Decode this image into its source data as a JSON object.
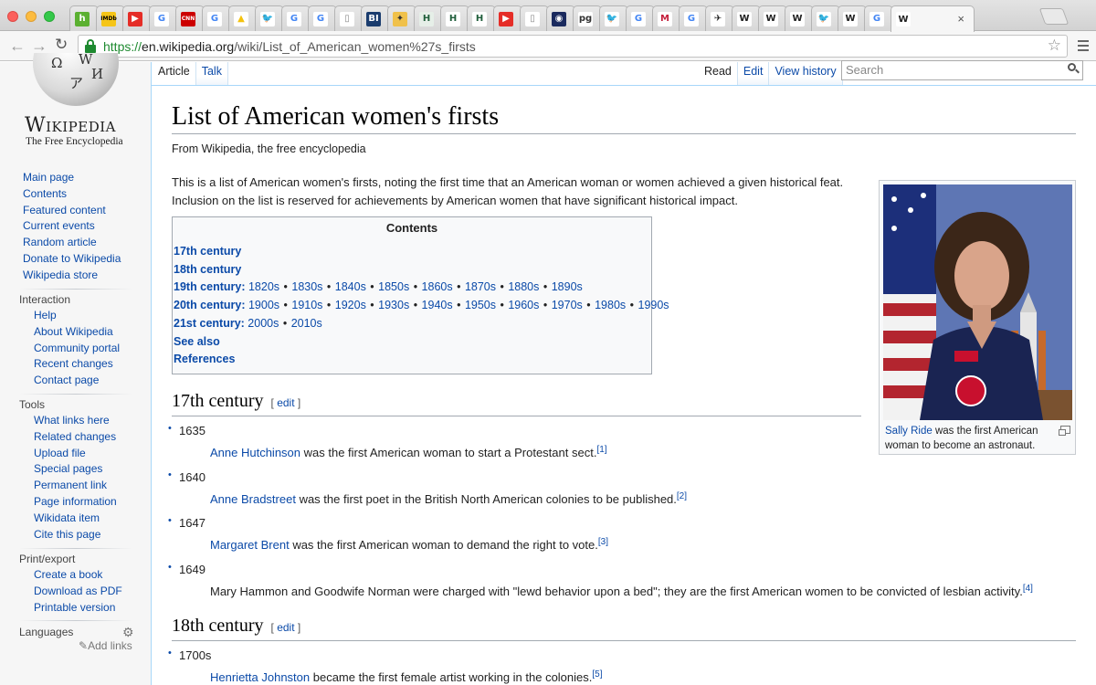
{
  "browser": {
    "url_scheme": "https://",
    "url_host": "en.wikipedia.org",
    "url_path": "/wiki/List_of_American_women%27s_firsts",
    "tabs": [
      {
        "icon": "h",
        "title": "",
        "color": "#5bb031",
        "fg": "#fff"
      },
      {
        "icon": "IMDb",
        "title": "",
        "color": "#f5c518",
        "fg": "#000"
      },
      {
        "icon": "▶",
        "title": "",
        "color": "#e52d27",
        "fg": "#fff"
      },
      {
        "icon": "G",
        "title": "",
        "color": "#fff",
        "fg": "#4285f4"
      },
      {
        "icon": "CNN",
        "title": "",
        "color": "#cc0000",
        "fg": "#fff"
      },
      {
        "icon": "G",
        "title": "",
        "color": "#fff",
        "fg": "#4285f4"
      },
      {
        "icon": "▲",
        "title": "",
        "color": "#fff",
        "fg": "#f4c20d"
      },
      {
        "icon": "🐦",
        "title": "",
        "color": "#fff",
        "fg": "#1da1f2"
      },
      {
        "icon": "G",
        "title": "",
        "color": "#fff",
        "fg": "#4285f4"
      },
      {
        "icon": "G",
        "title": "",
        "color": "#fff",
        "fg": "#4285f4"
      },
      {
        "icon": "▯",
        "title": "",
        "color": "#fff",
        "fg": "#888"
      },
      {
        "icon": "BI",
        "title": "",
        "color": "#1a3c6e",
        "fg": "#fff"
      },
      {
        "icon": "✦",
        "title": "",
        "color": "#f0c14b",
        "fg": "#333"
      },
      {
        "icon": "H",
        "title": "",
        "color": "#e6efe8",
        "fg": "#205e3b"
      },
      {
        "icon": "H",
        "title": "",
        "color": "#fff",
        "fg": "#205e3b"
      },
      {
        "icon": "H",
        "title": "",
        "color": "#fff",
        "fg": "#205e3b"
      },
      {
        "icon": "▶",
        "title": "",
        "color": "#e52d27",
        "fg": "#fff"
      },
      {
        "icon": "▯",
        "title": "",
        "color": "#fff",
        "fg": "#888"
      },
      {
        "icon": "◉",
        "title": "",
        "color": "#1a2a5e",
        "fg": "#fff"
      },
      {
        "icon": "pg",
        "title": "",
        "color": "#fff",
        "fg": "#333"
      },
      {
        "icon": "🐦",
        "title": "",
        "color": "#fff",
        "fg": "#1da1f2"
      },
      {
        "icon": "G",
        "title": "",
        "color": "#fff",
        "fg": "#4285f4"
      },
      {
        "icon": "M",
        "title": "",
        "color": "#fff",
        "fg": "#c41e3a"
      },
      {
        "icon": "G",
        "title": "",
        "color": "#fff",
        "fg": "#4285f4"
      },
      {
        "icon": "✈",
        "title": "",
        "color": "#fff",
        "fg": "#222"
      },
      {
        "icon": "W",
        "title": "",
        "color": "#fff",
        "fg": "#222"
      },
      {
        "icon": "W",
        "title": "",
        "color": "#fff",
        "fg": "#222"
      },
      {
        "icon": "W",
        "title": "",
        "color": "#fff",
        "fg": "#222"
      },
      {
        "icon": "🐦",
        "title": "",
        "color": "#fff",
        "fg": "#1da1f2"
      },
      {
        "icon": "W",
        "title": "",
        "color": "#fff",
        "fg": "#222"
      },
      {
        "icon": "G",
        "title": "",
        "color": "#fff",
        "fg": "#4285f4"
      }
    ],
    "active_tab": {
      "icon": "W",
      "title": "",
      "close": "×"
    }
  },
  "logo": {
    "wordmark": "Wikipedia",
    "tagline": "The Free Encyclopedia"
  },
  "sidebar": {
    "navigation": [
      "Main page",
      "Contents",
      "Featured content",
      "Current events",
      "Random article",
      "Donate to Wikipedia",
      "Wikipedia store"
    ],
    "interaction": {
      "heading": "Interaction",
      "items": [
        "Help",
        "About Wikipedia",
        "Community portal",
        "Recent changes",
        "Contact page"
      ]
    },
    "tools": {
      "heading": "Tools",
      "items": [
        "What links here",
        "Related changes",
        "Upload file",
        "Special pages",
        "Permanent link",
        "Page information",
        "Wikidata item",
        "Cite this page"
      ]
    },
    "print": {
      "heading": "Print/export",
      "items": [
        "Create a book",
        "Download as PDF",
        "Printable version"
      ]
    },
    "languages": {
      "heading": "Languages",
      "add_links": "Add links"
    }
  },
  "page_tabs": {
    "left": [
      "Article",
      "Talk"
    ],
    "right": [
      "Read",
      "Edit",
      "View history"
    ],
    "search_placeholder": "Search"
  },
  "article": {
    "title": "List of American women's firsts",
    "site_sub": "From Wikipedia, the free encyclopedia",
    "intro": "This is a list of American women's firsts, noting the first time that an American woman or women achieved a given historical feat. Inclusion on the list is reserved for achievements by American women that have significant historical impact.",
    "toc": {
      "title": "Contents",
      "lines": [
        {
          "label": "17th century",
          "subs": []
        },
        {
          "label": "18th century",
          "subs": []
        },
        {
          "label": "19th century:",
          "subs": [
            "1820s",
            "1830s",
            "1840s",
            "1850s",
            "1860s",
            "1870s",
            "1880s",
            "1890s"
          ]
        },
        {
          "label": "20th century:",
          "subs": [
            "1900s",
            "1910s",
            "1920s",
            "1930s",
            "1940s",
            "1950s",
            "1960s",
            "1970s",
            "1980s",
            "1990s"
          ]
        },
        {
          "label": "21st century:",
          "subs": [
            "2000s",
            "2010s"
          ]
        },
        {
          "label": "See also",
          "subs": []
        },
        {
          "label": "References",
          "subs": []
        }
      ]
    },
    "thumb": {
      "caption_link": "Sally Ride",
      "caption_rest": " was the first American woman to become an astronaut."
    },
    "sections": [
      {
        "heading": "17th century",
        "edit": "edit",
        "entries": [
          {
            "year": "1635",
            "link": "Anne Hutchinson",
            "text": " was the first American woman to start a Protestant sect.",
            "ref": "[1]"
          },
          {
            "year": "1640",
            "link": "Anne Bradstreet",
            "text": " was the first poet in the British North American colonies to be published.",
            "ref": "[2]"
          },
          {
            "year": "1647",
            "link": "Margaret Brent",
            "text": " was the first American woman to demand the right to vote.",
            "ref": "[3]"
          },
          {
            "year": "1649",
            "link": "",
            "text": "Mary Hammon and Goodwife Norman were charged with \"lewd behavior upon a bed\"; they are the first American women to be convicted of lesbian activity.",
            "ref": "[4]"
          }
        ]
      },
      {
        "heading": "18th century",
        "edit": "edit",
        "entries": [
          {
            "year": "1700s",
            "link": "Henrietta Johnston",
            "text": " became the first female artist working in the colonies.",
            "ref": "[5]"
          }
        ]
      }
    ]
  }
}
